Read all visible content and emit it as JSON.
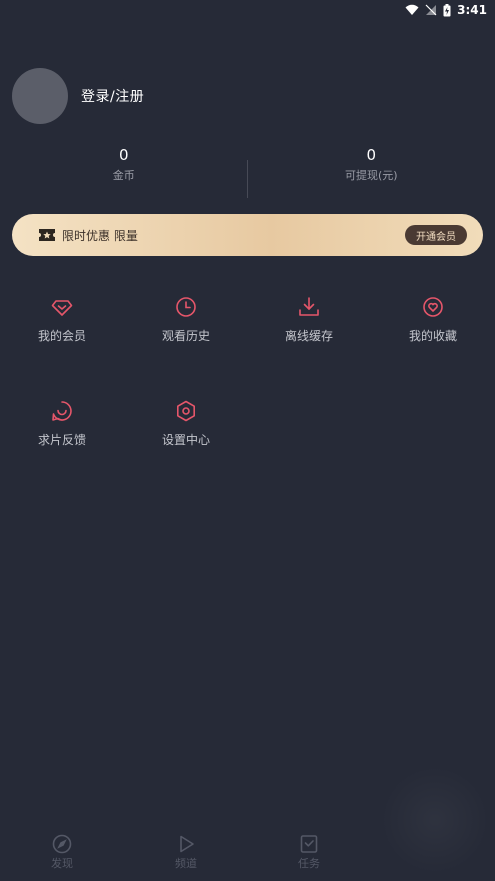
{
  "status_bar": {
    "time": "3:41"
  },
  "profile": {
    "login_label": "登录/注册"
  },
  "stats": [
    {
      "value": "0",
      "label": "金币"
    },
    {
      "value": "0",
      "label": "可提现(元)"
    }
  ],
  "vip_banner": {
    "text": "限时优惠 限量",
    "button_label": "开通会员"
  },
  "grid": {
    "my_vip": "我的会员",
    "history": "观看历史",
    "offline_cache": "离线缓存",
    "favorites": "我的收藏",
    "feedback": "求片反馈",
    "settings": "设置中心"
  },
  "tabs": {
    "discover": "发现",
    "channel": "频道",
    "tasks": "任务"
  },
  "colors": {
    "accent": "#e5566a",
    "background": "#262a37",
    "vip_gold": "#e7c9a1"
  }
}
